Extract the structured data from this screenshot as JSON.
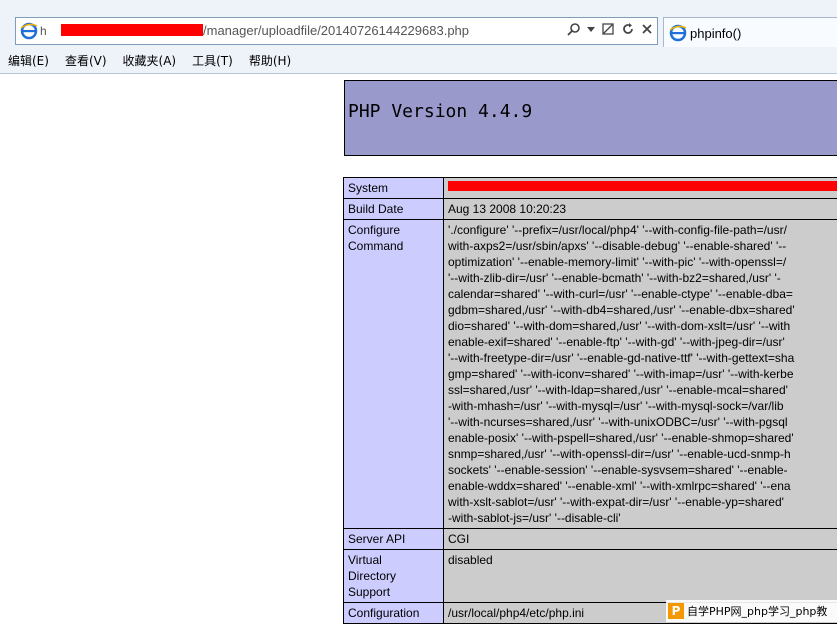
{
  "browser": {
    "address_prefix": "h",
    "address_url": "/manager/uploadfile/20140726144229683.php",
    "tab_title": "phpinfo()",
    "menu": [
      "编辑(E)",
      "查看(V)",
      "收藏夹(A)",
      "工具(T)",
      "帮助(H)"
    ],
    "address_tools": [
      "search-icon",
      "dropdown-arrow-icon",
      "compat-view-icon",
      "refresh-icon",
      "stop-icon"
    ]
  },
  "phpinfo": {
    "title": "PHP Version 4.4.9",
    "rows": [
      {
        "key": "System",
        "value": ""
      },
      {
        "key": "Build Date",
        "value": "Aug 13 2008 10:20:23"
      },
      {
        "key": "Configure\nCommand",
        "value": "'./configure' '--prefix=/usr/local/php4' '--with-config-file-path=/usr/\nwith-axps2=/usr/sbin/apxs' '--disable-debug' '--enable-shared' '--\noptimization' '--enable-memory-limit' '--with-pic' '--with-openssl=/\n'--with-zlib-dir=/usr' '--enable-bcmath' '--with-bz2=shared,/usr' '-\ncalendar=shared' '--with-curl=/usr' '--enable-ctype' '--enable-dba=\ngdbm=shared,/usr' '--with-db4=shared,/usr' '--enable-dbx=shared'\ndio=shared' '--with-dom=shared,/usr' '--with-dom-xslt=/usr' '--with\nenable-exif=shared' '--enable-ftp' '--with-gd' '--with-jpeg-dir=/usr'\n'--with-freetype-dir=/usr' '--enable-gd-native-ttf' '--with-gettext=sha\ngmp=shared' '--with-iconv=shared' '--with-imap=/usr' '--with-kerbe\nssl=shared,/usr' '--with-ldap=shared,/usr' '--enable-mcal=shared'\n-with-mhash=/usr' '--with-mysql=/usr' '--with-mysql-sock=/var/lib\n'--with-ncurses=shared,/usr' '--with-unixODBC=/usr' '--with-pgsql\nenable-posix' '--with-pspell=shared,/usr' '--enable-shmop=shared'\nsnmp=shared,/usr' '--with-openssl-dir=/usr' '--enable-ucd-snmp-h\nsockets' '--enable-session' '--enable-sysvsem=shared' '--enable-\nenable-wddx=shared' '--enable-xml' '--with-xmlrpc=shared' '--ena\nwith-xslt-sablot=/usr' '--with-expat-dir=/usr' '--enable-yp=shared'\n-with-sablot-js=/usr' '--disable-cli'"
      },
      {
        "key": "Server API",
        "value": "CGI"
      },
      {
        "key": "Virtual\nDirectory\nSupport",
        "value": "disabled"
      },
      {
        "key": "Configuration",
        "value": "/usr/local/php4/etc/php.ini"
      }
    ]
  },
  "watermark": {
    "logo": "P",
    "text": "自学PHP网_php学习_php教"
  },
  "colors": {
    "header_bg": "#9999cc",
    "key_bg": "#ccccff",
    "value_bg": "#cccccc",
    "redaction": "#ff0000"
  }
}
